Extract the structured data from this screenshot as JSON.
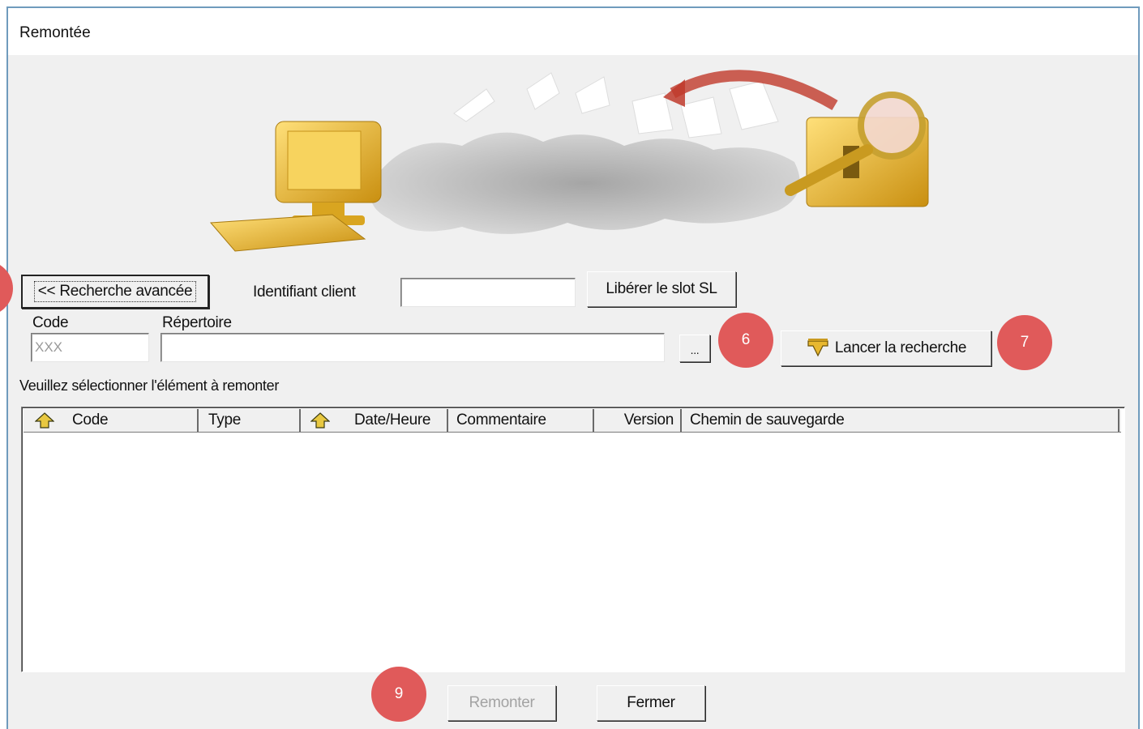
{
  "window": {
    "title": "Remontée"
  },
  "search_bar": {
    "advanced_button_label": "<< Recherche avancée",
    "client_id_label": "Identifiant client",
    "client_id_value": "",
    "free_slot_button_label": "Libérer le slot SL"
  },
  "filters": {
    "code_label": "Code",
    "code_value": "XXX",
    "directory_label": "Répertoire",
    "directory_value": "",
    "browse_button_label": "...",
    "search_button_label": "Lancer la recherche"
  },
  "list": {
    "caption": "Veuillez sélectionner l'élément à remonter",
    "columns": [
      "Code",
      "Type",
      "Date/Heure",
      "Commentaire",
      "Version",
      "Chemin de sauvegarde"
    ],
    "rows": []
  },
  "footer": {
    "upload_button_label": "Remonter",
    "close_button_label": "Fermer"
  },
  "callouts": [
    "6",
    "7",
    "9"
  ],
  "colors": {
    "callout": "#e05a5a",
    "window_border": "#6f9bbd",
    "icon_gold": "#e8b830"
  }
}
